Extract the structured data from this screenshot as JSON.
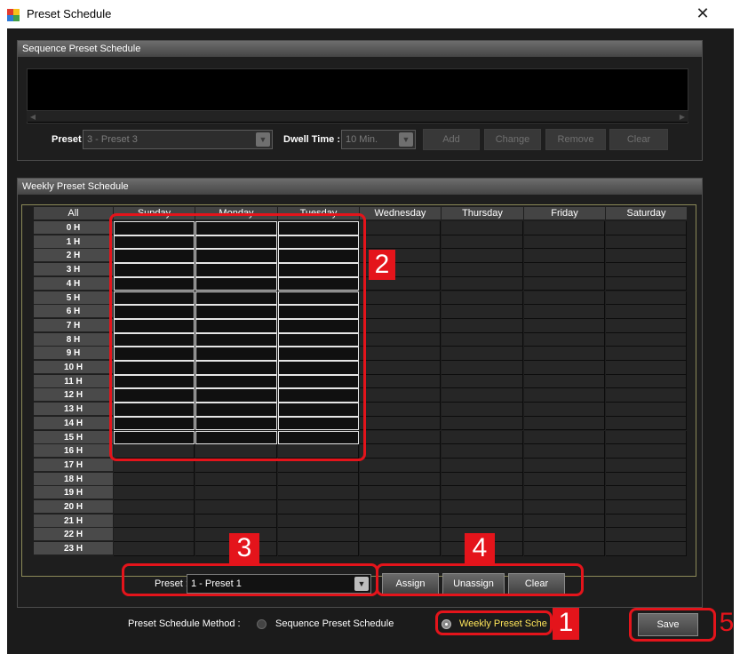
{
  "window": {
    "title": "Preset Schedule",
    "close_glyph": "✕"
  },
  "sequence": {
    "title": "Sequence Preset Schedule",
    "preset_label": "Preset :",
    "preset_value": "3  - Preset 3",
    "dwell_label": "Dwell Time :",
    "dwell_value": "10 Min.",
    "buttons": [
      "Add",
      "Change",
      "Remove",
      "Clear"
    ]
  },
  "weekly": {
    "title": "Weekly Preset Schedule",
    "all_label": "All",
    "days": [
      "Sunday",
      "Monday",
      "Tuesday",
      "Wednesday",
      "Thursday",
      "Friday",
      "Saturday"
    ],
    "hours": [
      "0 H",
      "1 H",
      "2 H",
      "3 H",
      "4 H",
      "5 H",
      "6 H",
      "7 H",
      "8 H",
      "9 H",
      "10 H",
      "11 H",
      "12 H",
      "13 H",
      "14 H",
      "15 H",
      "16 H",
      "17 H",
      "18 H",
      "19 H",
      "20 H",
      "21 H",
      "22 H",
      "23 H"
    ],
    "selected_days": [
      "Sunday",
      "Monday",
      "Tuesday"
    ],
    "selected_hours": [
      "0 H",
      "15 H"
    ],
    "preset_label": "Preset :",
    "preset_value": "1  - Preset 1",
    "assign_label": "Assign",
    "unassign_label": "Unassign",
    "clear_label": "Clear"
  },
  "method": {
    "label": "Preset Schedule Method :",
    "option_sequence": "Sequence Preset Schedule",
    "option_weekly": "Weekly Preset Sche",
    "selected": "Weekly Preset Sche"
  },
  "save_label": "Save",
  "annotations": [
    "1",
    "2",
    "3",
    "4",
    "5"
  ],
  "colors": {
    "annotation": "#e4141b",
    "accent_text": "#ffe65a",
    "background": "#1b1b1b"
  },
  "icons": {
    "app": "preset-schedule-app-icon",
    "close": "close-icon",
    "dropdown": "chevron-down-icon"
  }
}
